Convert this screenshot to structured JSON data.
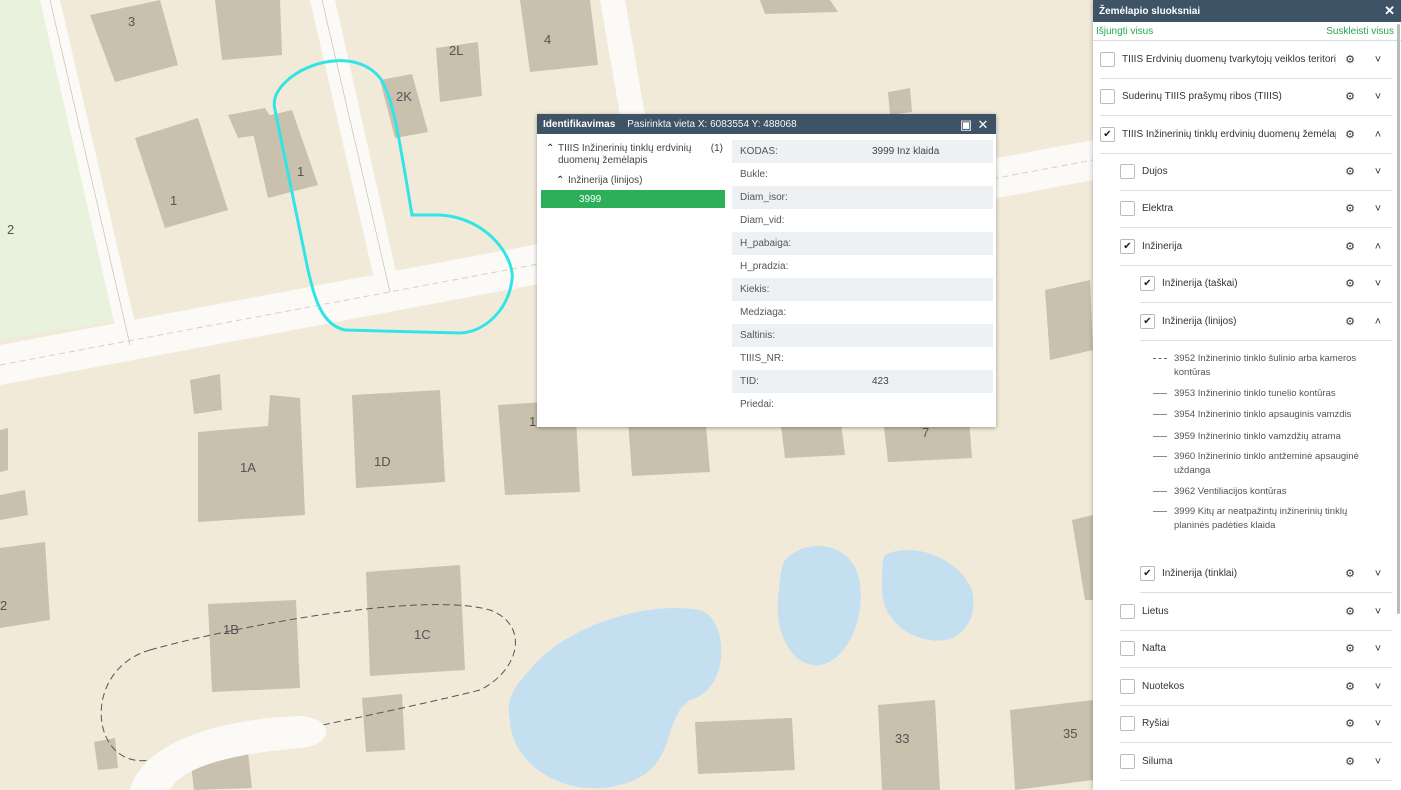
{
  "map": {
    "house_labels": [
      "3",
      "4",
      "2L",
      "2K",
      "1",
      "1",
      "2",
      "1A",
      "1D",
      "1",
      "7",
      "1B",
      "1C",
      "2",
      "33",
      "35"
    ]
  },
  "identify": {
    "title": "Identifikavimas",
    "location": "Pasirinkta vieta X: 6083554 Y: 488068",
    "tree": {
      "layer": "TIIIS Inžinerinių tinklų erdvinių duomenų žemėlapis",
      "count": "(1)",
      "sublayer": "Inžinerija (linijos)",
      "selected": "3999"
    },
    "attributes": [
      {
        "key": "KODAS:",
        "value": "3999 Inz klaida"
      },
      {
        "key": "Bukle:",
        "value": ""
      },
      {
        "key": "Diam_isor:",
        "value": ""
      },
      {
        "key": "Diam_vid:",
        "value": ""
      },
      {
        "key": "H_pabaiga:",
        "value": ""
      },
      {
        "key": "H_pradzia:",
        "value": ""
      },
      {
        "key": "Kiekis:",
        "value": ""
      },
      {
        "key": "Medziaga:",
        "value": ""
      },
      {
        "key": "Saltinis:",
        "value": ""
      },
      {
        "key": "TIIIS_NR:",
        "value": ""
      },
      {
        "key": "TID:",
        "value": "423"
      },
      {
        "key": "Priedai:",
        "value": ""
      }
    ]
  },
  "panel": {
    "title": "Žemėlapio sluoksniai",
    "disable_all": "Išjungti visus",
    "collapse_all": "Suskleisti visus",
    "layers": [
      {
        "label": "TIIIS Erdvinių duomenų tvarkytojų veiklos teritorijos",
        "checked": false,
        "expanded": false
      },
      {
        "label": "Suderinų TIIIS prašymų ribos (TIIIS)",
        "checked": false,
        "expanded": false
      },
      {
        "label": "TIIIS Inžinerinių tinklų erdvinių duomenų žemėlapis",
        "checked": true,
        "expanded": true
      },
      {
        "label": "Dujos",
        "checked": false,
        "expanded": false
      },
      {
        "label": "Elektra",
        "checked": false,
        "expanded": false
      },
      {
        "label": "Inžinerija",
        "checked": true,
        "expanded": true
      },
      {
        "label": "Inžinerija (taškai)",
        "checked": true,
        "expanded": false
      },
      {
        "label": "Inžinerija (linijos)",
        "checked": true,
        "expanded": true
      },
      {
        "label": "Inžinerija (tinklai)",
        "checked": true,
        "expanded": false
      },
      {
        "label": "Lietus",
        "checked": false,
        "expanded": false
      },
      {
        "label": "Nafta",
        "checked": false,
        "expanded": false
      },
      {
        "label": "Nuotekos",
        "checked": false,
        "expanded": false
      },
      {
        "label": "Ryšiai",
        "checked": false,
        "expanded": false
      },
      {
        "label": "Šiluma",
        "checked": false,
        "expanded": false
      }
    ],
    "legend": [
      "3952 Inžinerinio tinklo šulinio arba kameros kontūras",
      "3953 Inžinerinio tinklo tunelio kontūras",
      "3954 Inžinerinio tinklo apsauginis vamzdis",
      "3959 Inžinerinio tinklo vamzdžių atrama",
      "3960 Inžinerinio tinklo antžeminė apsauginė uždanga",
      "3962 Ventiliacijos kontūras",
      "3999 Kitų ar neatpažintų inžinerinių tinklų planinės padėties klaida"
    ],
    "icons": {
      "settings": "gear-icon",
      "expanded": "chevron-up-icon",
      "collapsed": "chevron-down-icon"
    }
  }
}
